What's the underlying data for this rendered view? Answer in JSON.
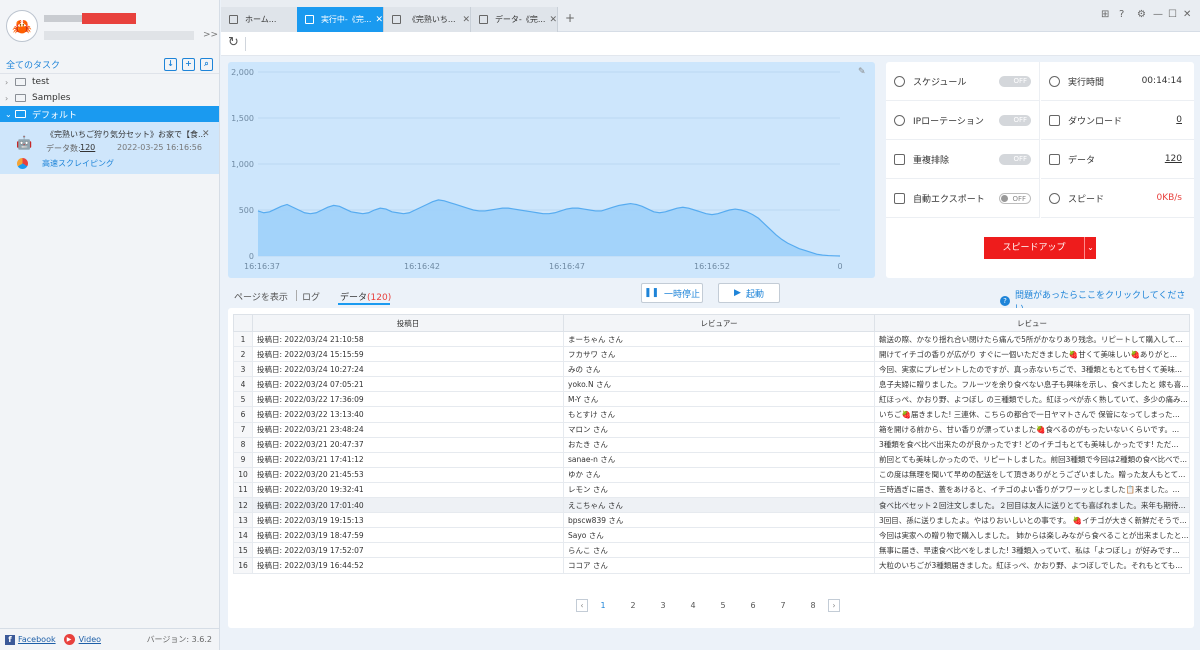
{
  "sidebar": {
    "all_tasks_label": "全てのタスク",
    "tree": [
      {
        "label": "test",
        "caret": "›"
      },
      {
        "label": "Samples",
        "caret": "›"
      },
      {
        "label": "デフォルト",
        "caret": "⌄"
      }
    ],
    "task": {
      "title": "《完熟いちご狩り気分セット》お家で【食...",
      "count_label": "データ数:",
      "count": "120",
      "date": "2022-03-25 16:16:56",
      "speed_label": "高速スクレイピング"
    },
    "footer": {
      "facebook": "Facebook",
      "video": "Video",
      "version": "バージョン: 3.6.2"
    }
  },
  "tabs": [
    {
      "label": "ホーム..."
    },
    {
      "label": "実行中-《完...",
      "active": true
    },
    {
      "label": "《完熟いち..."
    },
    {
      "label": "データ-《完..."
    }
  ],
  "chart_data": {
    "type": "area",
    "x_ticks": [
      "16:16:37",
      "16:16:42",
      "16:16:47",
      "16:16:52",
      "0"
    ],
    "y_ticks": [
      "0",
      "500",
      "1,000",
      "1,500",
      "2,000"
    ],
    "ylim": [
      0,
      2000
    ],
    "x": [
      0,
      3,
      6,
      9,
      12,
      15,
      18,
      21,
      24,
      27,
      30,
      33,
      36,
      39,
      42,
      45,
      48,
      51,
      54,
      57,
      60,
      63,
      66,
      69,
      72,
      75,
      78,
      81,
      84,
      87,
      90,
      93,
      96,
      99,
      102,
      105,
      108,
      111,
      114,
      117,
      120,
      123,
      126,
      129,
      132,
      135,
      138,
      141,
      144,
      147,
      150,
      153,
      156,
      159,
      162,
      165,
      168,
      171,
      174,
      177,
      180,
      183,
      186,
      189,
      192,
      195,
      198,
      201,
      204,
      207,
      210,
      213,
      216,
      219,
      222,
      225,
      228,
      231,
      234,
      237,
      240,
      243,
      246,
      249,
      252,
      255,
      258,
      261,
      264,
      267,
      270,
      273,
      276,
      279,
      282,
      285,
      288,
      291,
      294,
      297,
      300
    ],
    "values": [
      490,
      470,
      480,
      510,
      540,
      560,
      530,
      500,
      470,
      460,
      470,
      500,
      530,
      550,
      540,
      510,
      480,
      470,
      460,
      470,
      500,
      520,
      510,
      480,
      470,
      460,
      470,
      500,
      530,
      560,
      590,
      610,
      600,
      580,
      560,
      540,
      520,
      500,
      490,
      490,
      500,
      510,
      520,
      520,
      510,
      500,
      490,
      480,
      470,
      460,
      460,
      470,
      490,
      510,
      520,
      520,
      510,
      500,
      490,
      490,
      510,
      530,
      550,
      560,
      570,
      560,
      540,
      510,
      480,
      470,
      480,
      500,
      520,
      530,
      520,
      500,
      480,
      460,
      450,
      460,
      480,
      500,
      510,
      500,
      480,
      450,
      410,
      350,
      290,
      230,
      180,
      140,
      110,
      80,
      60,
      40,
      20,
      10,
      5,
      2,
      0
    ],
    "colors": {
      "fill": "#9fd0fa",
      "line": "#56abf0"
    }
  },
  "stats": {
    "schedule": {
      "label": "スケジュール",
      "toggle": "OFF"
    },
    "ip_rotation": {
      "label": "IPローテーション",
      "toggle": "OFF"
    },
    "dedupe": {
      "label": "重複排除",
      "toggle": "OFF"
    },
    "auto_export": {
      "label": "自動エクスポート",
      "toggle": "OFF"
    },
    "run_time": {
      "label": "実行時間",
      "value": "00:14:14"
    },
    "download": {
      "label": "ダウンロード",
      "value": "0"
    },
    "data": {
      "label": "データ",
      "value": "120"
    },
    "speed": {
      "label": "スピード",
      "value": "0KB/s"
    },
    "speedup_label": "スピードアップ"
  },
  "view": {
    "page_view": "ページを表示",
    "log": "ログ",
    "data_tab": "データ",
    "data_count": "(120)",
    "pause": "一時停止",
    "start": "起動",
    "help": "問題があったらここをクリックしてください"
  },
  "table": {
    "headers": [
      "投稿日",
      "レビュアー",
      "レビュー"
    ],
    "rows": [
      {
        "n": "1",
        "date": "投稿日: 2022/03/24 21:10:58",
        "user": "まーちゃん さん",
        "review": "輸送の際、かなり揺れ合い閉けたら痛んで5所がかなりあり残念。リピートして購入して..."
      },
      {
        "n": "2",
        "date": "投稿日: 2022/03/24 15:15:59",
        "user": "フカサワ さん",
        "review": "開けてイチゴの香りが広がり すぐに一個いただきました🍓甘くて美味しい🍓ありがと..."
      },
      {
        "n": "3",
        "date": "投稿日: 2022/03/24 10:27:24",
        "user": "みの さん",
        "review": "今回、実家にプレゼントしたのですが、真っ赤ないちごで、3種類ともとても甘くて美味..."
      },
      {
        "n": "4",
        "date": "投稿日: 2022/03/24 07:05:21",
        "user": "yoko.N さん",
        "review": "息子夫婦に贈りました。フルーツを余り食べない息子も興味を示し、食べましたと 嫁も喜..."
      },
      {
        "n": "5",
        "date": "投稿日: 2022/03/22 17:36:09",
        "user": "M-Y さん",
        "review": "紅ほっぺ、かおり野、よつぼし の三種類でした。紅ほっぺが赤く熟していて、多少の痛み..."
      },
      {
        "n": "6",
        "date": "投稿日: 2022/03/22 13:13:40",
        "user": "もとすけ さん",
        "review": "いちご🍓届きました! 三連休、こちらの都合で一日ヤマトさんで 保管になってしまった..."
      },
      {
        "n": "7",
        "date": "投稿日: 2022/03/21 23:48:24",
        "user": "マロン さん",
        "review": "箱を開ける前から、甘い香りが漂っていました🍓食べるのがもったいないくらいです。..."
      },
      {
        "n": "8",
        "date": "投稿日: 2022/03/21 20:47:37",
        "user": "おたき さん",
        "review": "3種類を食べ比べ出来たのが良かったです! どのイチゴもとても美味しかったです! ただ..."
      },
      {
        "n": "9",
        "date": "投稿日: 2022/03/21 17:41:12",
        "user": "sanae-n さん",
        "review": "前回とても美味しかったので、リピートしました。前回3種類で今回は2種類の食べ比べで..."
      },
      {
        "n": "10",
        "date": "投稿日: 2022/03/20 21:45:53",
        "user": "ゆか さん",
        "review": "この度は無理を聞いて早めの配送をして頂きありがとうございました。贈った友人もとて..."
      },
      {
        "n": "11",
        "date": "投稿日: 2022/03/20 19:32:41",
        "user": "レモン さん",
        "review": "三時過ぎに届き、蓋をあけると、イチゴのよい香りがフワーッとしました📋来ました。..."
      },
      {
        "n": "12",
        "date": "投稿日: 2022/03/20 17:01:40",
        "user": "えこちゃん さん",
        "review": "食べ比べセット２回注文しました。２回目は友人に送りとても喜ばれました。来年も期待..."
      },
      {
        "n": "13",
        "date": "投稿日: 2022/03/19 19:15:13",
        "user": "bpscw839 さん",
        "review": "3回目、孫に送りましたよ。やはりおいしいとの事です。 🍓イチゴが大きく新鮮だそうで..."
      },
      {
        "n": "14",
        "date": "投稿日: 2022/03/19 18:47:59",
        "user": "Sayo さん",
        "review": "今回は実家への贈り物で購入しました。 姉からは楽しみながら食べることが出来ましたと..."
      },
      {
        "n": "15",
        "date": "投稿日: 2022/03/19 17:52:07",
        "user": "らんこ さん",
        "review": "無事に届き、早速食べ比べをしました! 3種類入っていて、私は「よつぼし」が好みです..."
      },
      {
        "n": "16",
        "date": "投稿日: 2022/03/19 16:44:52",
        "user": "ココア さん",
        "review": "大粒のいちごが3種類届きました。紅ほっぺ、かおり野、よつぼしでした。それもとても..."
      }
    ],
    "pages": [
      "1",
      "2",
      "3",
      "4",
      "5",
      "6",
      "7",
      "8"
    ]
  }
}
